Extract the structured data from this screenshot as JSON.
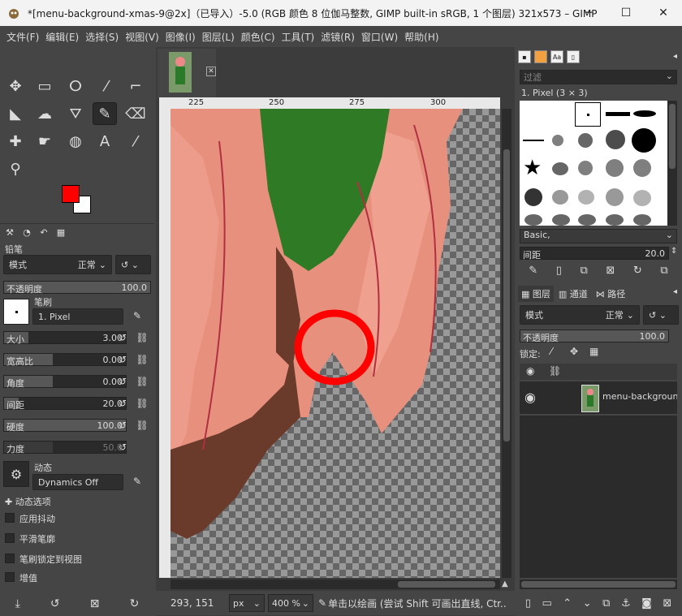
{
  "window": {
    "title": "*[menu-background-xmas-9@2x]（已导入）-5.0 (RGB 颜色 8 位伽马整数, GIMP built-in sRGB, 1 个图层) 321x573 – GIMP",
    "minimize": "─",
    "maximize": "☐",
    "close": "✕"
  },
  "menu": [
    "文件(F)",
    "编辑(E)",
    "选择(S)",
    "视图(V)",
    "图像(I)",
    "图层(L)",
    "颜色(C)",
    "工具(T)",
    "滤镜(R)",
    "窗口(W)",
    "帮助(H)"
  ],
  "colors": {
    "foreground": "#ff0000",
    "background": "#ffffff"
  },
  "tool_options": {
    "title": "铅笔",
    "mode_label": "模式",
    "mode_value": "正常",
    "opacity_label": "不透明度",
    "opacity_value": "100.0",
    "brush_label": "笔刷",
    "brush_value": "1. Pixel",
    "size_label": "大小",
    "size_value": "3.00",
    "aspect_label": "宽高比",
    "aspect_value": "0.00",
    "angle_label": "角度",
    "angle_value": "0.00",
    "spacing_label": "间距",
    "spacing_value": "20.0",
    "hardness_label": "硬度",
    "hardness_value": "100.0",
    "force_label": "力度",
    "force_value": "50.0",
    "dynamics_label": "动态",
    "dynamics_value": "Dynamics Off",
    "dynamics_options": "动态选项",
    "apply_jitter": "应用抖动",
    "smooth_stroke": "平滑笔廓",
    "lock_brush": "笔刷锁定到视图",
    "incremental": "增值"
  },
  "ruler": {
    "h": [
      "225",
      "250",
      "275",
      "300"
    ]
  },
  "status": {
    "coords": "293, 151",
    "unit": "px",
    "zoom": "400 %",
    "message": "单击以绘画 (尝试 Shift 可画出直线, Ctr..."
  },
  "brushes": {
    "filter_placeholder": "过滤",
    "title": "1. Pixel (3 × 3)",
    "preset": "Basic,",
    "spacing_label": "间距",
    "spacing_value": "20.0"
  },
  "layers": {
    "tab_layers": "图层",
    "tab_channels": "通道",
    "tab_paths": "路径",
    "mode_label": "模式",
    "mode_value": "正常",
    "opacity_label": "不透明度",
    "opacity_value": "100.0",
    "lock_label": "锁定:",
    "layer_name": "menu-background-x"
  }
}
